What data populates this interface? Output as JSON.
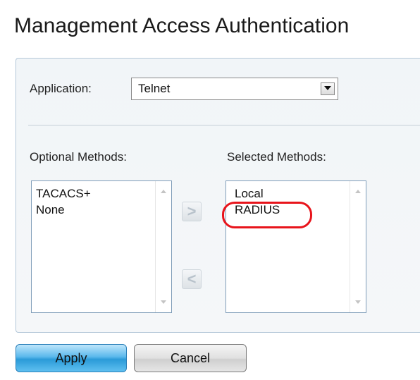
{
  "page": {
    "title": "Management Access Authentication"
  },
  "application": {
    "label": "Application:",
    "value": "Telnet"
  },
  "optional": {
    "label": "Optional Methods:",
    "items": [
      "TACACS+",
      "None"
    ]
  },
  "selected": {
    "label": "Selected Methods:",
    "items": [
      "Local",
      "RADIUS"
    ],
    "highlighted_item": "RADIUS",
    "highlight_color": "#e8141b"
  },
  "controls": {
    "add_icon": "chevron-right-icon",
    "add_glyph": ">",
    "remove_icon": "chevron-left-icon",
    "remove_glyph": "<"
  },
  "buttons": {
    "apply_label": "Apply",
    "cancel_label": "Cancel"
  },
  "colors": {
    "apply_button": "#2a9ad8",
    "panel_border": "#b3c7d8"
  }
}
